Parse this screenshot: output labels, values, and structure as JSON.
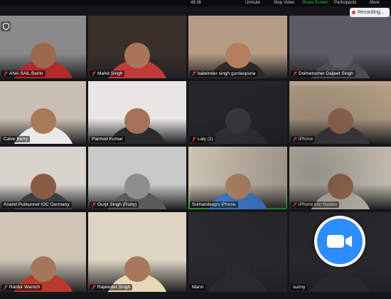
{
  "topbar": {
    "time": "48:36",
    "controls": [
      "Unmute",
      "Stop Video",
      "Share Screen",
      "Participants",
      "More"
    ]
  },
  "recording": {
    "label": "Recording..."
  },
  "participants": [
    {
      "name": "SAIL Berlin",
      "prefix": "ANA",
      "muted": true,
      "bg": "#8a8a8a",
      "skin": "#9a6a4e",
      "shirt": "#b22a2a"
    },
    {
      "name": "Malkit Singh",
      "muted": true,
      "bg": "#3a2f2a",
      "skin": "#a8755a",
      "shirt": "#c03a3a"
    },
    {
      "name": "balwinder singh gurdaspuria",
      "muted": true,
      "bg": "#b49d84",
      "skin": "#b57e5d",
      "shirt": "#2a2a2a"
    },
    {
      "name": "Dolmetscher Daljeet Singh",
      "muted": true,
      "bg": "#5a5c63",
      "skin": "#5a5c63",
      "shirt": "#4a4c52"
    },
    {
      "name": "Calve Berry",
      "muted": false,
      "bg": "#c9bfb2",
      "skin": "#a97a58",
      "shirt": "#eaeaea"
    },
    {
      "name": "Parmod Kumar",
      "muted": false,
      "bg": "#e8e6e2",
      "skin": "#a5715a",
      "shirt": "#2b2b2b"
    },
    {
      "name": "Laly (2)",
      "muted": true,
      "bg": "#262629",
      "skin": "#3a3a3e",
      "shirt": "#303034"
    },
    {
      "name": "iPhone",
      "muted": true,
      "bg": "#b9a48a",
      "skin": "#9b6e55",
      "shirt": "#3c3c42"
    },
    {
      "name": "Anand Pulikunnel IOC Germany",
      "muted": false,
      "bg": "#d8d3cc",
      "skin": "#8a5b44",
      "shirt": "#3a3d44"
    },
    {
      "name": "Gurjit Singh (Ruby)",
      "muted": true,
      "bg": "#c9c9c7",
      "skin": "#8e8e8c",
      "shirt": "#5a5a5a"
    },
    {
      "name": "Sumandeep's iPhone",
      "muted": false,
      "bg": "#cfc4b4",
      "skin": "#b88a6a",
      "shirt": "#3f7fd0"
    },
    {
      "name": "iPhone von Baldev",
      "muted": true,
      "bg": "#d9d2c5",
      "skin": "#a87658",
      "shirt": "#cfc9bd"
    },
    {
      "name": "Ranbir Warrich",
      "muted": true,
      "bg": "#cfc4b6",
      "skin": "#a6765a",
      "shirt": "#b83a2a"
    },
    {
      "name": "Rajeinder Singh",
      "muted": true,
      "bg": "#ddd4c2",
      "skin": "#a9775b",
      "shirt": "#e8d9b5"
    },
    {
      "name": "Mann",
      "muted": false,
      "bg": "#2a2a2d",
      "skin": "#2a2a2d",
      "shirt": "#2a2a2d"
    },
    {
      "name": "sunny",
      "muted": false,
      "bg": "#2a2a2d",
      "skin": "#2a2a2d",
      "shirt": "#2a2a2d"
    }
  ],
  "colors": {
    "active_speaker_border": "#27c93f",
    "zoom_blue": "#2d8cff",
    "muted_icon": "#e23b3b"
  },
  "icons": {
    "logo": "zoom-video-camera-icon",
    "shield": "security-shield-icon"
  }
}
